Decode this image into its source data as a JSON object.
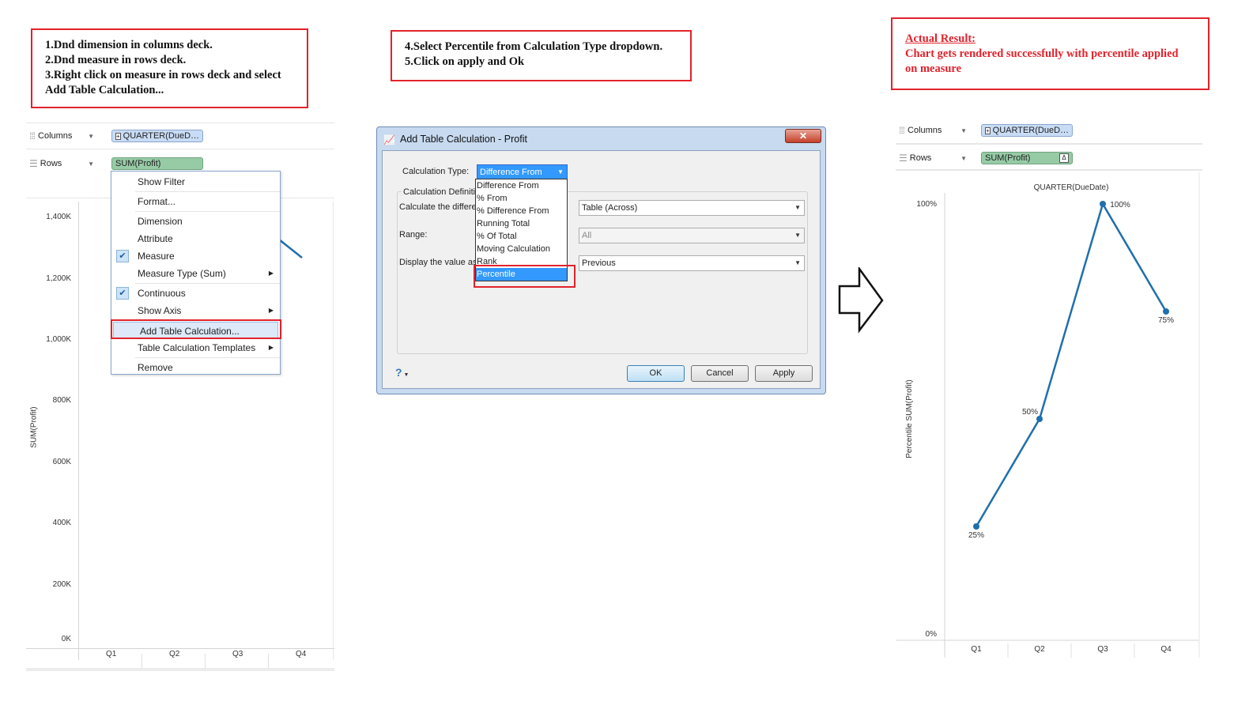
{
  "notes": {
    "left": [
      "1.Dnd dimension in columns deck.",
      "2.Dnd measure in rows deck.",
      "3.Right click on measure in rows deck and select",
      "Add Table Calculation..."
    ],
    "middle": [
      "4.Select Percentile from Calculation Type dropdown.",
      "5.Click on apply and Ok"
    ],
    "right_title": "Actual Result:",
    "right_lines": [
      "Chart gets rendered successfully with percentile applied",
      "on measure"
    ]
  },
  "left_panel": {
    "columns_label": "Columns",
    "rows_label": "Rows",
    "columns_pill": "QUARTER(DueD…",
    "rows_pill": "SUM(Profit)",
    "y_axis_title": "SUM(Profit)",
    "y_ticks": [
      "1,400K",
      "1,200K",
      "1,000K",
      "800K",
      "600K",
      "400K",
      "200K",
      "0K"
    ],
    "x_ticks": [
      "Q1",
      "Q2",
      "Q3",
      "Q4"
    ],
    "context_menu": [
      {
        "label": "Show Filter"
      },
      {
        "sep": true
      },
      {
        "label": "Format..."
      },
      {
        "sep": true
      },
      {
        "label": "Dimension"
      },
      {
        "label": "Attribute"
      },
      {
        "label": "Measure",
        "checked": true
      },
      {
        "label": "Measure Type (Sum)",
        "submenu": true
      },
      {
        "sep": true
      },
      {
        "label": "Continuous",
        "checked": true
      },
      {
        "label": "Show Axis",
        "submenu": true
      },
      {
        "sep": true
      },
      {
        "label": "Add Table Calculation...",
        "highlighted": true
      },
      {
        "label": "Table Calculation Templates",
        "submenu": true
      },
      {
        "sep": true
      },
      {
        "label": "Remove"
      }
    ]
  },
  "dialog": {
    "title": "Add Table Calculation - Profit",
    "close_icon": "close-icon",
    "calc_type_label": "Calculation Type:",
    "calc_type_value": "Difference From",
    "calc_def_label": "Calculation Definitio",
    "calculate_label": "Calculate the differe",
    "range_label": "Range:",
    "display_label": "Display the value as",
    "calculate_value": "Table (Across)",
    "range_value": "All",
    "display_value": "Previous",
    "dropdown_options": [
      "Difference From",
      "% From",
      "% Difference From",
      "Running Total",
      "% Of Total",
      "Moving Calculation",
      "Rank",
      "Percentile"
    ],
    "selected_option": "Percentile",
    "help_icon": "?",
    "ok": "OK",
    "cancel": "Cancel",
    "apply": "Apply"
  },
  "right_panel": {
    "columns_label": "Columns",
    "rows_label": "Rows",
    "columns_pill": "QUARTER(DueD…",
    "rows_pill": "SUM(Profit)"
  },
  "chart_data": {
    "type": "line",
    "title": "QUARTER(DueDate)",
    "xlabel": "",
    "ylabel": "Percentile SUM(Profit)",
    "categories": [
      "Q1",
      "Q2",
      "Q3",
      "Q4"
    ],
    "values": [
      25,
      50,
      100,
      75
    ],
    "data_labels": [
      "25%",
      "50%",
      "100%",
      "75%"
    ],
    "y_ticks": [
      "100%",
      "0%"
    ],
    "ylim": [
      0,
      100
    ],
    "line_color": "#1f6fad"
  }
}
